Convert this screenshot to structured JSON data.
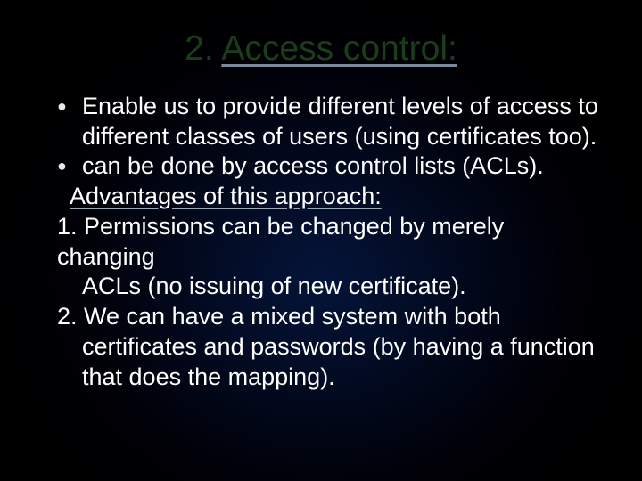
{
  "title": {
    "prefix": "2. ",
    "underlined": "Access control:"
  },
  "content": {
    "b1_line1": "Enable us to provide different levels of access to",
    "b1_line2": "different classes of users (using certificates too).",
    "b2_line1": "can be done by access control lists (ACLs).",
    "adv_heading": "Advantages of this approach:",
    "adv1_line1": "1. Permissions can be changed by merely changing",
    "adv1_line2": "ACLs (no issuing of new certificate).",
    "adv2_line1": "2. We can have a mixed system with both",
    "adv2_line2": "certificates and passwords (by having a function",
    "adv2_line3": "that does the mapping)."
  }
}
